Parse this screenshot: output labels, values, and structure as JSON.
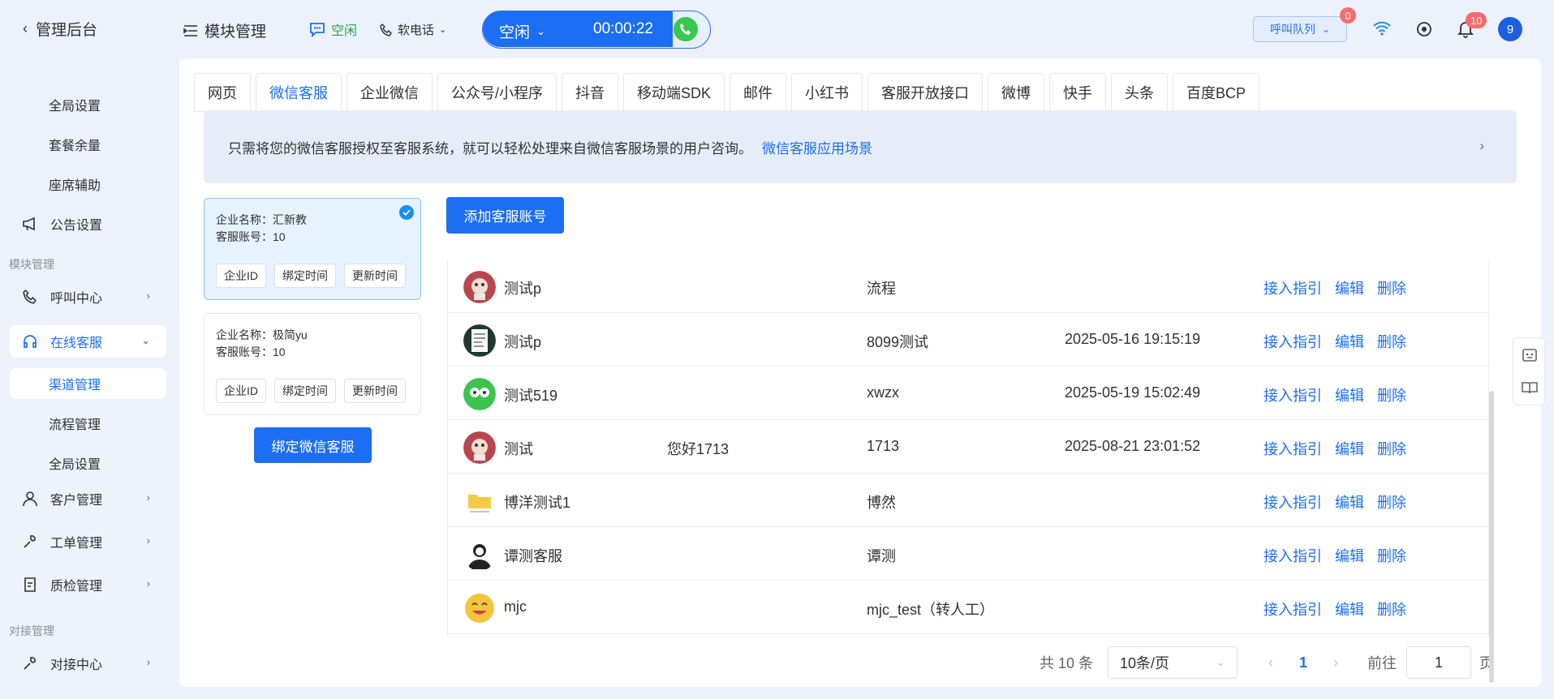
{
  "header": {
    "back_label": "管理后台",
    "module_label": "模块管理",
    "status_label": "空闲",
    "phone_label": "软电话",
    "call_state": "空闲",
    "call_timer": "00:00:22",
    "queue_label": "呼叫队列",
    "queue_badge": "0",
    "notify_badge": "10",
    "avatar_text": "9"
  },
  "sidebar": {
    "subitems_top": [
      "全局设置",
      "套餐余量",
      "座席辅助"
    ],
    "announce": "公告设置",
    "group_module": "模块管理",
    "call_center": "呼叫中心",
    "online_service": "在线客服",
    "online_children": [
      "渠道管理",
      "流程管理",
      "全局设置"
    ],
    "customer": "客户管理",
    "ticket": "工单管理",
    "quality": "质检管理",
    "group_integration": "对接管理",
    "integration_center": "对接中心"
  },
  "tabs": [
    "网页",
    "微信客服",
    "企业微信",
    "公众号/小程序",
    "抖音",
    "移动端SDK",
    "邮件",
    "小红书",
    "客服开放接口",
    "微博",
    "快手",
    "头条",
    "百度BCP"
  ],
  "active_tab": "微信客服",
  "banner": {
    "text": "只需将您的微信客服授权至客服系统，就可以轻松处理来自微信客服场景的用户咨询。",
    "link": "微信客服应用场景"
  },
  "corps": [
    {
      "name_line": "企业名称：汇新教",
      "count_line": "客服账号：10",
      "btn_id": "企业ID",
      "btn_bind": "绑定时间",
      "btn_update": "更新时间",
      "selected": true
    },
    {
      "name_line": "企业名称：极简yu",
      "count_line": "客服账号：10",
      "btn_id": "企业ID",
      "btn_bind": "绑定时间",
      "btn_update": "更新时间",
      "selected": false
    }
  ],
  "bind_button": "绑定微信客服",
  "add_button": "添加客服账号",
  "rows": [
    {
      "name": "测试p",
      "welcome": "",
      "flow": "流程",
      "time": "",
      "avatar": "doll",
      "ops": [
        "接入指引",
        "编辑",
        "删除"
      ]
    },
    {
      "name": "测试p",
      "welcome": "",
      "flow": "8099测试",
      "time": "2025-05-16 19:15:19",
      "avatar": "doc",
      "ops": [
        "接入指引",
        "编辑",
        "删除"
      ]
    },
    {
      "name": "测试519",
      "welcome": "",
      "flow": "xwzx",
      "time": "2025-05-19 15:02:49",
      "avatar": "green",
      "ops": [
        "接入指引",
        "编辑",
        "删除"
      ]
    },
    {
      "name": "测试",
      "welcome": "您好1713",
      "flow": "1713",
      "time": "2025-08-21 23:01:52",
      "avatar": "doll",
      "ops": [
        "接入指引",
        "编辑",
        "删除"
      ]
    },
    {
      "name": "博洋测试1",
      "welcome": "",
      "flow": "博然",
      "time": "",
      "avatar": "folder",
      "ops": [
        "接入指引",
        "编辑",
        "删除"
      ]
    },
    {
      "name": "谭测客服",
      "welcome": "",
      "flow": "谭测",
      "time": "",
      "avatar": "agent",
      "ops": [
        "接入指引",
        "编辑",
        "删除"
      ]
    },
    {
      "name": "mjc",
      "welcome": "",
      "flow": "mjc_test（转人工）",
      "time": "",
      "avatar": "emoji",
      "ops": [
        "接入指引",
        "编辑",
        "删除"
      ]
    }
  ],
  "pager": {
    "total": "共 10 条",
    "page_size": "10条/页",
    "current": "1",
    "goto_label": "前往",
    "goto_value": "1",
    "page_suffix": "页"
  },
  "colors": {
    "accent": "#1c6ef2",
    "success": "#37c84f",
    "badge": "#f56c6c"
  }
}
